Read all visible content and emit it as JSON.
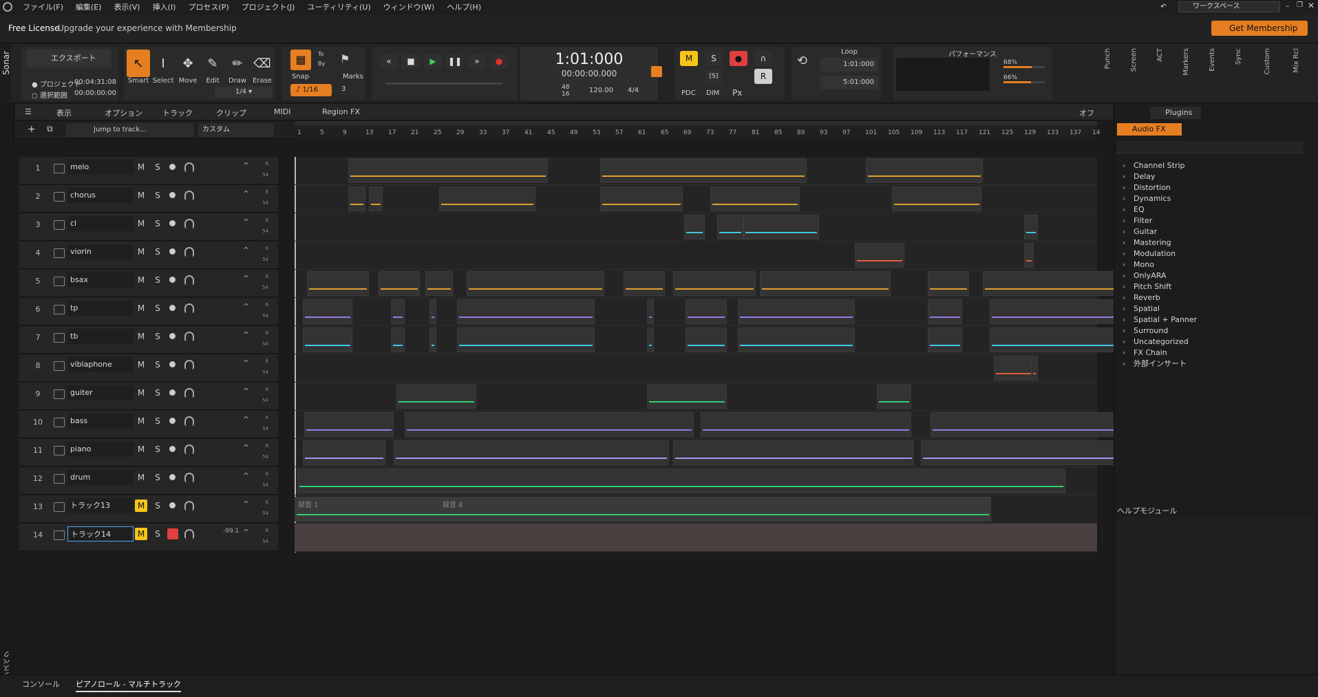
{
  "menu": [
    "ファイル(F)",
    "編集(E)",
    "表示(V)",
    "挿入(I)",
    "プロセス(P)",
    "プロジェクト(J)",
    "ユーティリティ(U)",
    "ウィンドウ(W)",
    "ヘルプ(H)"
  ],
  "workspace": "ワークスペース",
  "license": {
    "title": "Free License",
    "msg": "Upgrade your experience with Membership",
    "cta": "Get Membership"
  },
  "sidebar_brand": "Sonar",
  "export": {
    "label": "エクスポート",
    "project": "プロジェクト",
    "project_time": "00:04:31:08",
    "selection": "選択範囲",
    "selection_time": "00:00:00:00"
  },
  "tools": [
    "Smart",
    "Select",
    "Move",
    "Edit",
    "Draw",
    "Erase"
  ],
  "grid": "1/4",
  "snap": {
    "label": "Snap",
    "to": "To",
    "by": "By",
    "value": "1/16",
    "marks": "Marks",
    "marks_val": "3"
  },
  "transport": {
    "time": "1:01:000",
    "time2": "00:00:00.000",
    "tempo": "120.00",
    "meter": "4/4",
    "ts_top": "48",
    "ts_bot": "16"
  },
  "mix": {
    "M": "M",
    "S": "S",
    "R": "R",
    "pdc": "PDC",
    "dim": "DIM",
    "s_box": "[S]",
    "px": "Px"
  },
  "loop": {
    "label": "Loop",
    "start": "1:01:000",
    "end": "5:01:000"
  },
  "performance": {
    "label": "パフォーマンス",
    "cpu": "68%",
    "disk": "66%"
  },
  "side_tabs": [
    "Punch",
    "Screen",
    "ACT",
    "Markers",
    "Events",
    "Sync",
    "Custom",
    "Mix Rcl"
  ],
  "subheader": {
    "view": "表示",
    "options": "オプション",
    "track": "トラック",
    "clip": "クリップ",
    "midi": "MIDI",
    "regionfx": "Region FX",
    "off": "オフ"
  },
  "trackbar": {
    "jump": "Jump to track...",
    "custom": "カスタム"
  },
  "ruler": [
    "1",
    "5",
    "9",
    "13",
    "17",
    "21",
    "25",
    "29",
    "33",
    "37",
    "41",
    "45",
    "49",
    "53",
    "57",
    "61",
    "65",
    "69",
    "73",
    "77",
    "81",
    "85",
    "89",
    "93",
    "97",
    "101",
    "105",
    "109",
    "113",
    "117",
    "121",
    "125",
    "129",
    "133",
    "137",
    "14"
  ],
  "tracks": [
    {
      "num": "1",
      "name": "melo",
      "color": "#e0a030"
    },
    {
      "num": "2",
      "name": "chorus",
      "color": "#e0a030"
    },
    {
      "num": "3",
      "name": "cl",
      "color": "#40c8d8"
    },
    {
      "num": "4",
      "name": "viorin",
      "color": "#e0603c"
    },
    {
      "num": "5",
      "name": "bsax",
      "color": "#e0a030"
    },
    {
      "num": "6",
      "name": "tp",
      "color": "#9a7ae8"
    },
    {
      "num": "7",
      "name": "tb",
      "color": "#40c8f0"
    },
    {
      "num": "8",
      "name": "viblaphone",
      "color": "#e0603c"
    },
    {
      "num": "9",
      "name": "guiter",
      "color": "#30d070"
    },
    {
      "num": "10",
      "name": "bass",
      "color": "#9a7ae8"
    },
    {
      "num": "11",
      "name": "piano",
      "color": "#a890f0"
    },
    {
      "num": "12",
      "name": "drum",
      "color": "#30d070"
    },
    {
      "num": "13",
      "name": "トラック13",
      "color": "#30d070"
    },
    {
      "num": "14",
      "name": "トラック14",
      "color": "#30d070",
      "vol": "-99.1"
    }
  ],
  "audio_clips": [
    "録音 1",
    "録音 8"
  ],
  "plugins": {
    "tab": "Plugins",
    "audio": "Audio FX",
    "items": [
      "Channel Strip",
      "Delay",
      "Distortion",
      "Dynamics",
      "EQ",
      "Filter",
      "Guitar",
      "Mastering",
      "Modulation",
      "Mono",
      "OnlyARA",
      "Pitch Shift",
      "Reverb",
      "Spatial",
      "Spatial + Panner",
      "Surround",
      "Uncategorized",
      "FX Chain",
      "外部インサート"
    ]
  },
  "help": "ヘルプモジュール",
  "bottom_tabs": [
    "コンソール",
    "ピアノロール - マルチトラック"
  ],
  "inspector": "インスペクタ",
  "clip_tags": [
    "=",
    "="
  ]
}
